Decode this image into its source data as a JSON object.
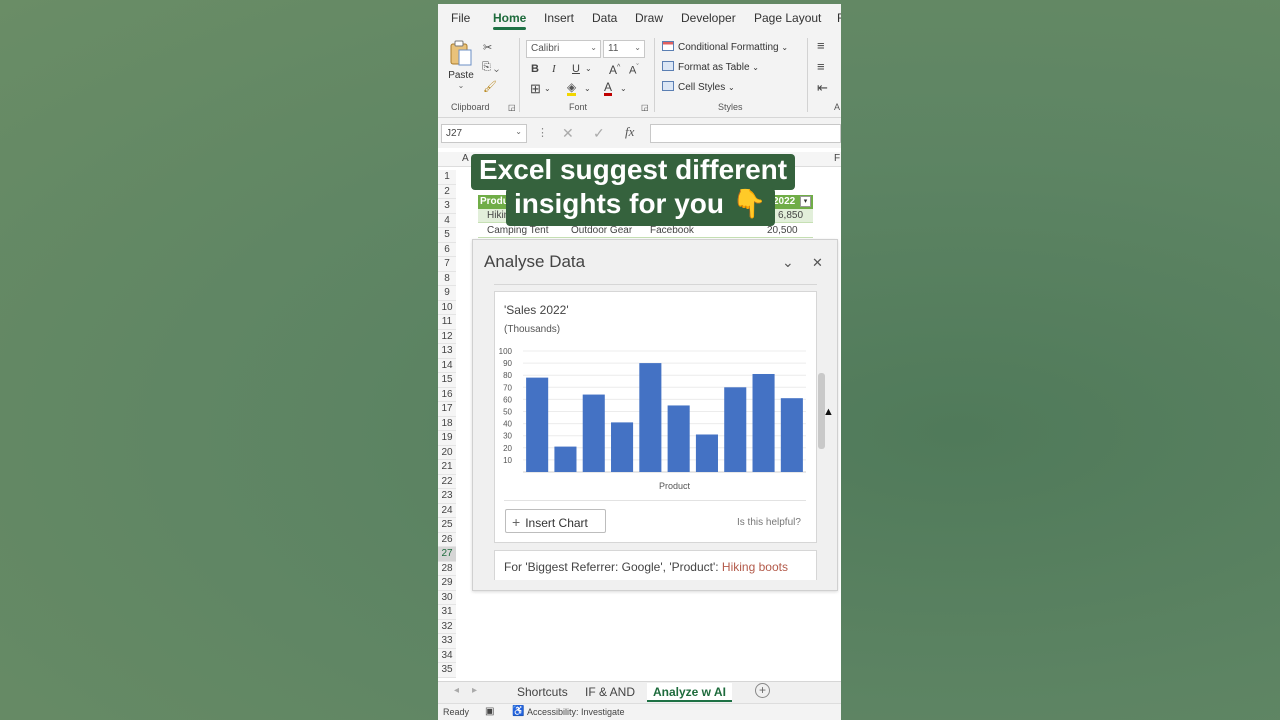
{
  "ribbon": {
    "tabs": [
      "File",
      "Home",
      "Insert",
      "Data",
      "Draw",
      "Developer",
      "Page Layout",
      "F"
    ],
    "active_tab": "Home",
    "paste_label": "Paste",
    "clipboard_label": "Clipboard",
    "font_label": "Font",
    "styles_label": "Styles",
    "alignment_label": "A",
    "font_name": "Calibri",
    "font_size": "11",
    "bold": "B",
    "italic": "I",
    "underline": "U",
    "increase_font": "A^",
    "decrease_font": "A˅",
    "font_color": "A",
    "conditional_formatting": "Conditional Formatting",
    "format_as_table": "Format as Table",
    "cell_styles": "Cell Styles"
  },
  "formula_bar": {
    "name_box": "J27",
    "fx": "fx",
    "value": ""
  },
  "grid": {
    "col_first": "A",
    "col_last": "F",
    "selected_row": 27,
    "row4": {
      "product": "Hikin",
      "sales": "6,850"
    },
    "row3": {
      "product": "Produ",
      "sales": "2022"
    },
    "row5": {
      "product": "Camping Tent",
      "category": "Outdoor Gear",
      "referrer": "Facebook",
      "sales": "20,500"
    }
  },
  "caption": {
    "line1": "Excel suggest different",
    "line2": "insights for you 👇"
  },
  "panel": {
    "title": "Analyse Data",
    "card_title": "'Sales 2022'",
    "card_subtitle": "(Thousands)",
    "insert_chart": "Insert Chart",
    "helpful": "Is this helpful?",
    "next_insight_prefix": "For 'Biggest Referrer: Google', 'Product': ",
    "next_insight_value": "Hiking boots"
  },
  "chart_data": {
    "type": "bar",
    "title": "'Sales 2022'",
    "subtitle": "(Thousands)",
    "xlabel": "Product",
    "ylabel": "",
    "ylim": [
      0,
      100
    ],
    "yticks": [
      "10",
      "20",
      "30",
      "40",
      "50",
      "60",
      "70",
      "80",
      "90",
      "100"
    ],
    "values": [
      78,
      21,
      64,
      41,
      90,
      55,
      31,
      70,
      81,
      61
    ],
    "color": "#4472c4"
  },
  "sheets": {
    "tabs": [
      "Shortcuts",
      "IF & AND",
      "Analyze w AI"
    ],
    "active": "Analyze w AI"
  },
  "status": {
    "ready": "Ready",
    "accessibility": "Accessibility: Investigate"
  }
}
